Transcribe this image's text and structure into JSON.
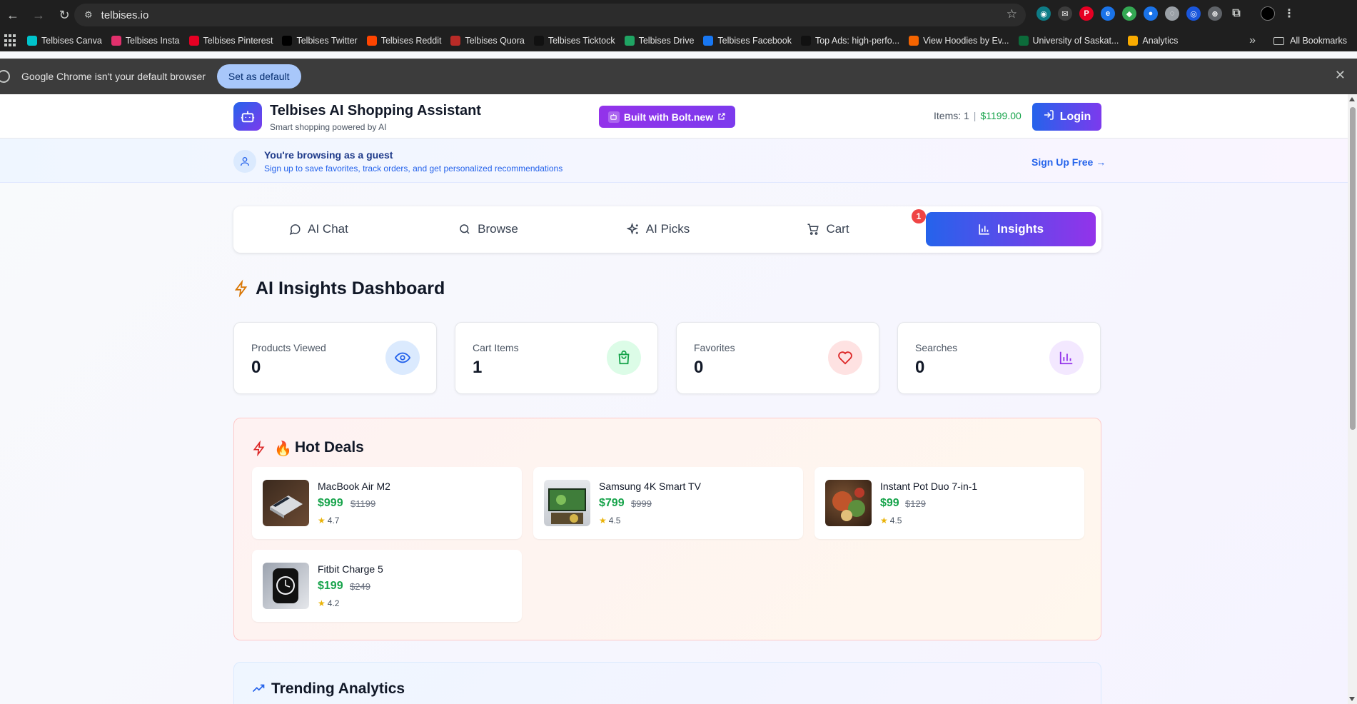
{
  "browser": {
    "url": "telbises.io",
    "bookmarks": [
      {
        "label": "Telbises Canva",
        "color": "#00c4cc"
      },
      {
        "label": "Telbises Insta",
        "color": "#e1306c"
      },
      {
        "label": "Telbises Pinterest",
        "color": "#e60023"
      },
      {
        "label": "Telbises Twitter",
        "color": "#000000"
      },
      {
        "label": "Telbises Reddit",
        "color": "#ff4500"
      },
      {
        "label": "Telbises Quora",
        "color": "#b92b27"
      },
      {
        "label": "Telbises Ticktock",
        "color": "#111111"
      },
      {
        "label": "Telbises Drive",
        "color": "#1fa463"
      },
      {
        "label": "Telbises Facebook",
        "color": "#1877f2"
      },
      {
        "label": "Top Ads: high-perfo...",
        "color": "#111111"
      },
      {
        "label": "View Hoodies by Ev...",
        "color": "#f56400"
      },
      {
        "label": "University of Saskat...",
        "color": "#0c6b3a"
      },
      {
        "label": "Analytics",
        "color": "#f9ab00"
      }
    ],
    "all_bookmarks": "All Bookmarks",
    "infobar_text": "Google Chrome isn't your default browser",
    "set_default_label": "Set as default"
  },
  "header": {
    "title": "Telbises AI Shopping Assistant",
    "subtitle": "Smart shopping powered by AI",
    "bolt_label": "Built with Bolt.new",
    "items_label": "Items: 1",
    "total": "$1199.00",
    "login_label": "Login"
  },
  "guest": {
    "title": "You're browsing as a guest",
    "subtitle": "Sign up to save favorites, track orders, and get personalized recommendations",
    "signup_label": "Sign Up Free →"
  },
  "tabs": [
    {
      "label": "AI Chat",
      "icon": "chat-bubble-icon"
    },
    {
      "label": "Browse",
      "icon": "search-icon"
    },
    {
      "label": "AI Picks",
      "icon": "sparkles-icon"
    },
    {
      "label": "Cart",
      "icon": "cart-icon",
      "badge": "1"
    },
    {
      "label": "Insights",
      "icon": "bar-chart-icon",
      "active": true
    }
  ],
  "dashboard": {
    "title": "AI Insights Dashboard",
    "stats": [
      {
        "label": "Products Viewed",
        "value": "0",
        "icon": "eye-icon",
        "color": "#2563eb",
        "bg": "#dbeafe"
      },
      {
        "label": "Cart Items",
        "value": "1",
        "icon": "shopping-bag-icon",
        "color": "#16a34a",
        "bg": "#dcfce7"
      },
      {
        "label": "Favorites",
        "value": "0",
        "icon": "heart-icon",
        "color": "#dc2626",
        "bg": "#fee2e2"
      },
      {
        "label": "Searches",
        "value": "0",
        "icon": "bar-chart-icon",
        "color": "#9333ea",
        "bg": "#f3e8ff"
      }
    ]
  },
  "hot_deals": {
    "title": "Hot Deals",
    "items": [
      {
        "name": "MacBook Air M2",
        "price": "$999",
        "old_price": "$1199",
        "rating": "4.7"
      },
      {
        "name": "Samsung 4K Smart TV",
        "price": "$799",
        "old_price": "$999",
        "rating": "4.5"
      },
      {
        "name": "Instant Pot Duo 7-in-1",
        "price": "$99",
        "old_price": "$129",
        "rating": "4.5"
      },
      {
        "name": "Fitbit Charge 5",
        "price": "$199",
        "old_price": "$249",
        "rating": "4.2"
      }
    ]
  },
  "trending": {
    "title": "Trending Analytics"
  }
}
